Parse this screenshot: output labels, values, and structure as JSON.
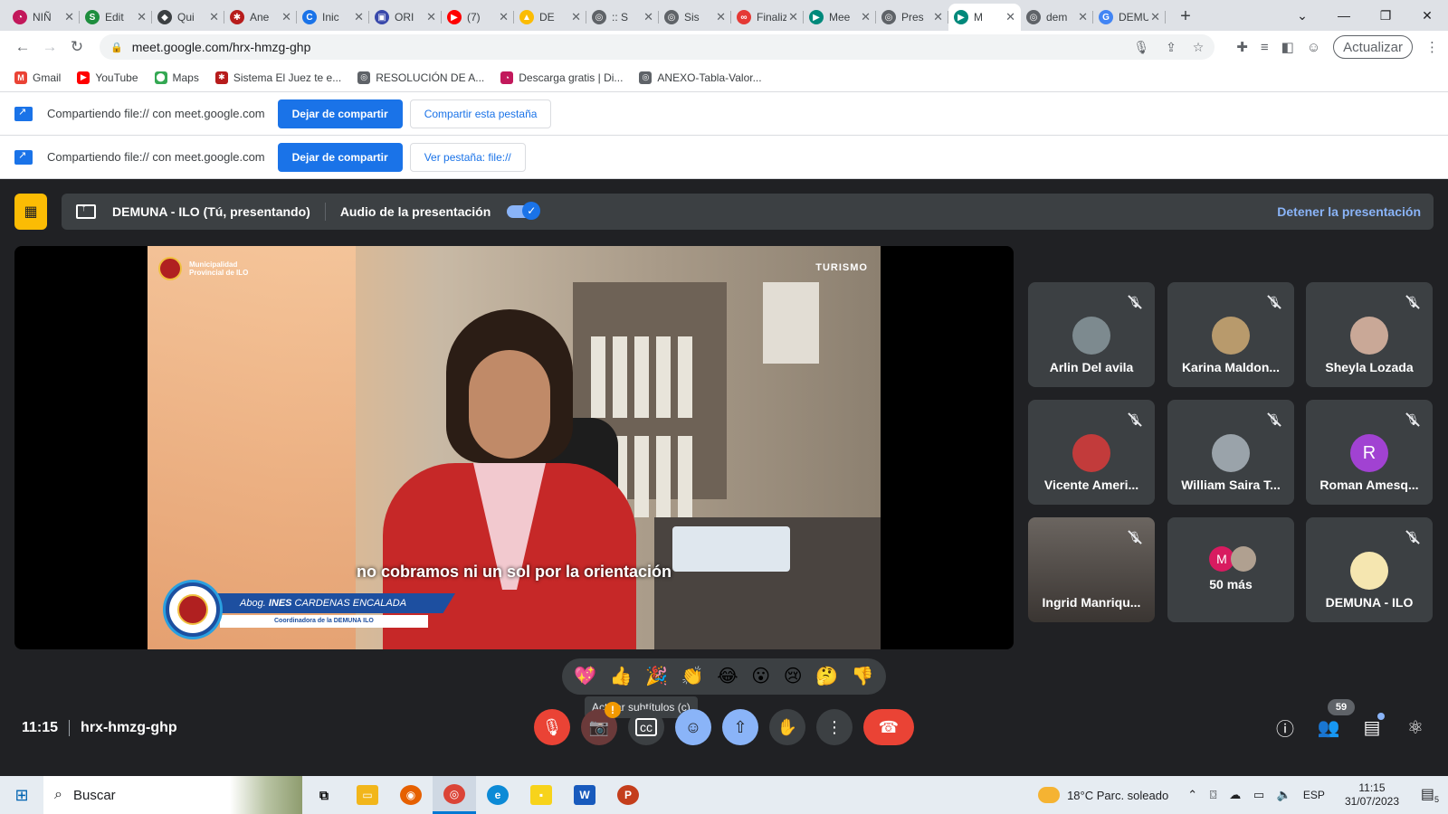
{
  "browser": {
    "tabs": [
      {
        "label": "NIÑ",
        "color": "#c2185b",
        "glyph": "◔"
      },
      {
        "label": "Edit",
        "color": "#1e8e3e",
        "glyph": "S"
      },
      {
        "label": "Qui",
        "color": "#3c4043",
        "glyph": "◆"
      },
      {
        "label": "Ane",
        "color": "#b71c1c",
        "glyph": "✱"
      },
      {
        "label": "Inic",
        "color": "#1a73e8",
        "glyph": "C"
      },
      {
        "label": "ORI",
        "color": "#3949ab",
        "glyph": "▣"
      },
      {
        "label": "(7)",
        "color": "#ff0000",
        "glyph": "▶"
      },
      {
        "label": "DE",
        "color": "#fbbc04",
        "glyph": "▲"
      },
      {
        "label": ":: S",
        "color": "#5f6368",
        "glyph": "◎"
      },
      {
        "label": "Sis",
        "color": "#5f6368",
        "glyph": "◎"
      },
      {
        "label": "Finaliza",
        "color": "#e53935",
        "glyph": "∞"
      },
      {
        "label": "Mee",
        "color": "#00897b",
        "glyph": "▶"
      },
      {
        "label": "Pres",
        "color": "#5f6368",
        "glyph": "◎"
      },
      {
        "label": "M",
        "color": "#00897b",
        "glyph": "▶"
      },
      {
        "label": "dem",
        "color": "#5f6368",
        "glyph": "◎"
      },
      {
        "label": "DEMUN",
        "color": "#4285f4",
        "glyph": "G"
      }
    ],
    "active_tab_index": 13,
    "url": "meet.google.com/hrx-hmzg-ghp",
    "update_label": "Actualizar",
    "bookmarks": [
      {
        "label": "Gmail",
        "color": "#ea4335",
        "glyph": "M"
      },
      {
        "label": "YouTube",
        "color": "#ff0000",
        "glyph": "▶"
      },
      {
        "label": "Maps",
        "color": "#34a853",
        "glyph": "⬤"
      },
      {
        "label": "Sistema El Juez te e...",
        "color": "#b71c1c",
        "glyph": "✱"
      },
      {
        "label": "RESOLUCIÓN DE A...",
        "color": "#5f6368",
        "glyph": "◎"
      },
      {
        "label": "Descarga gratis | Di...",
        "color": "#c2185b",
        "glyph": "◔"
      },
      {
        "label": "ANEXO-Tabla-Valor...",
        "color": "#5f6368",
        "glyph": "◎"
      }
    ]
  },
  "infobars": [
    {
      "text": "Compartiendo file:// con meet.google.com",
      "primary": "Dejar de compartir",
      "secondary": "Compartir esta pestaña"
    },
    {
      "text": "Compartiendo file:// con meet.google.com",
      "primary": "Dejar de compartir",
      "secondary": "Ver pestaña: file://"
    }
  ],
  "meet": {
    "presenter_title": "DEMUNA - ILO (Tú, presentando)",
    "audio_label": "Audio de la presentación",
    "audio_enabled": true,
    "stop_label": "Detener la presentación",
    "video": {
      "caption": "no cobramos ni un sol por la orientación",
      "logo_left": "Municipalidad Provincial de ILO",
      "logo_right": "TURISMO",
      "lower_third_name_prefix": "Abog. ",
      "lower_third_name_bold": "INES",
      "lower_third_name_rest": " CARDENAS ENCALADA",
      "lower_third_role": "Coordinadora de la DEMUNA ILO"
    },
    "participants": [
      {
        "name": "Arlin Del avila",
        "avatar": "photo",
        "color": "#7d8a8f"
      },
      {
        "name": "Karina Maldon...",
        "avatar": "photo",
        "color": "#b89a6c"
      },
      {
        "name": "Sheyla Lozada",
        "avatar": "photo",
        "color": "#c9a897"
      },
      {
        "name": "Vicente Ameri...",
        "avatar": "photo",
        "color": "#c23b3b"
      },
      {
        "name": "William Saira T...",
        "avatar": "photo",
        "color": "#9aa3aa"
      },
      {
        "name": "Roman Amesq...",
        "avatar": "R",
        "color": "#a142d2"
      },
      {
        "name": "Ingrid Manriqu...",
        "avatar": "video",
        "color": "#5a544f"
      },
      {
        "name": "50 más",
        "avatar": "group",
        "color": "#d81b60"
      },
      {
        "name": "DEMUNA - ILO",
        "avatar": "photo",
        "color": "#f5e6b0"
      }
    ],
    "more_avatar_letter": "M",
    "reactions": [
      "💖",
      "👍",
      "🎉",
      "👏",
      "😂",
      "😮",
      "😢",
      "🤔",
      "👎"
    ],
    "tooltip": "Activar subtítulos (c)",
    "time": "11:15",
    "meeting_code": "hrx-hmzg-ghp",
    "participant_count": "59"
  },
  "taskbar": {
    "search_placeholder": "Buscar",
    "weather": "18°C  Parc. soleado",
    "language": "ESP",
    "clock_time": "11:15",
    "clock_date": "31/07/2023",
    "notification_count": "5"
  }
}
